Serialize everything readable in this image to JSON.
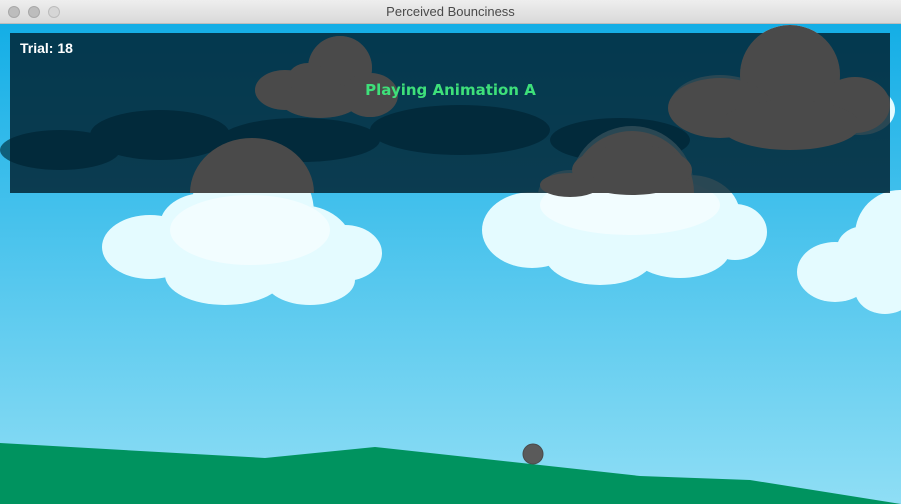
{
  "window": {
    "title": "Perceived Bounciness"
  },
  "hud": {
    "trial_label": "Trial: 18",
    "status": "Playing Animation A"
  },
  "colors": {
    "sky_top": "#1ab0e6",
    "sky_bottom": "#88dcf4",
    "ground": "#00935f",
    "cloud": "#eafcff",
    "cloud_dim": "#4a4a4a",
    "ball": "#5a5a5a",
    "status_text": "#3ee07a",
    "overlay": "#001e2d"
  }
}
